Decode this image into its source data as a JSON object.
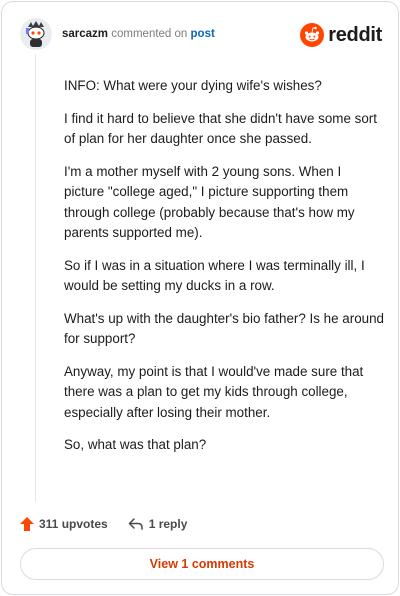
{
  "header": {
    "username": "sarcazm",
    "action_text": "commented on",
    "post_link": "post",
    "brand": "reddit"
  },
  "comment": {
    "paragraphs": [
      "INFO: What were your dying wife's wishes?",
      "I find it hard to believe that she didn't have some sort of plan for her daughter once she passed.",
      "I'm a mother myself with 2 young sons. When I picture \"college aged,\" I picture supporting them through college (probably because that's how my parents supported me).",
      "So if I was in a situation where I was terminally ill, I would be setting my ducks in a row.",
      "What's up with the daughter's bio father? Is he around for support?",
      "Anyway, my point is that I would've made sure that there was a plan to get my kids through college, especially after losing their mother.",
      "So, what was that plan?"
    ]
  },
  "actions": {
    "upvotes": "311 upvotes",
    "replies": "1 reply"
  },
  "footer": {
    "view_comments": "View 1 comments"
  },
  "colors": {
    "brand_orange": "#ff4500",
    "link_blue": "#0a66b8",
    "button_text": "#d93a00"
  }
}
